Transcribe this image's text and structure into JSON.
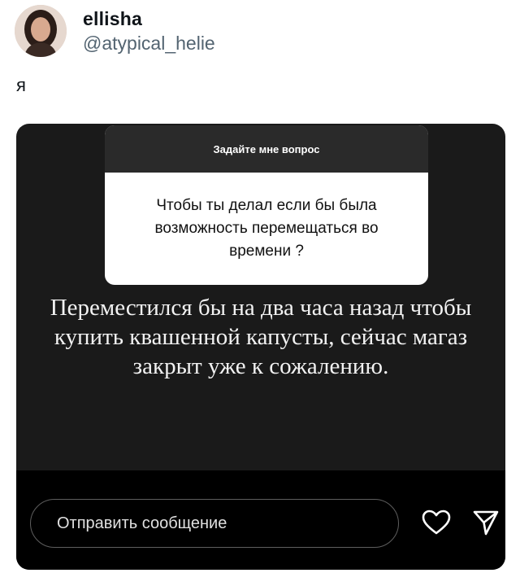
{
  "tweet": {
    "display_name": "ellisha",
    "handle": "@atypical_helie",
    "text": "я"
  },
  "story": {
    "question_title": "Задайте мне вопрос",
    "question_text": "Чтобы ты делал если бы была возможность перемещаться во времени ?",
    "answer_text": "Переместился бы на два часа назад чтобы купить квашенной капусты, сейчас магаз закрыт уже к сожалению.",
    "message_placeholder": "Отправить сообщение"
  },
  "icons": {
    "like": "heart-icon",
    "send": "send-icon"
  },
  "colors": {
    "story_background": "#1a1a1a",
    "bottom_bar": "#000000",
    "handle": "#536471"
  }
}
